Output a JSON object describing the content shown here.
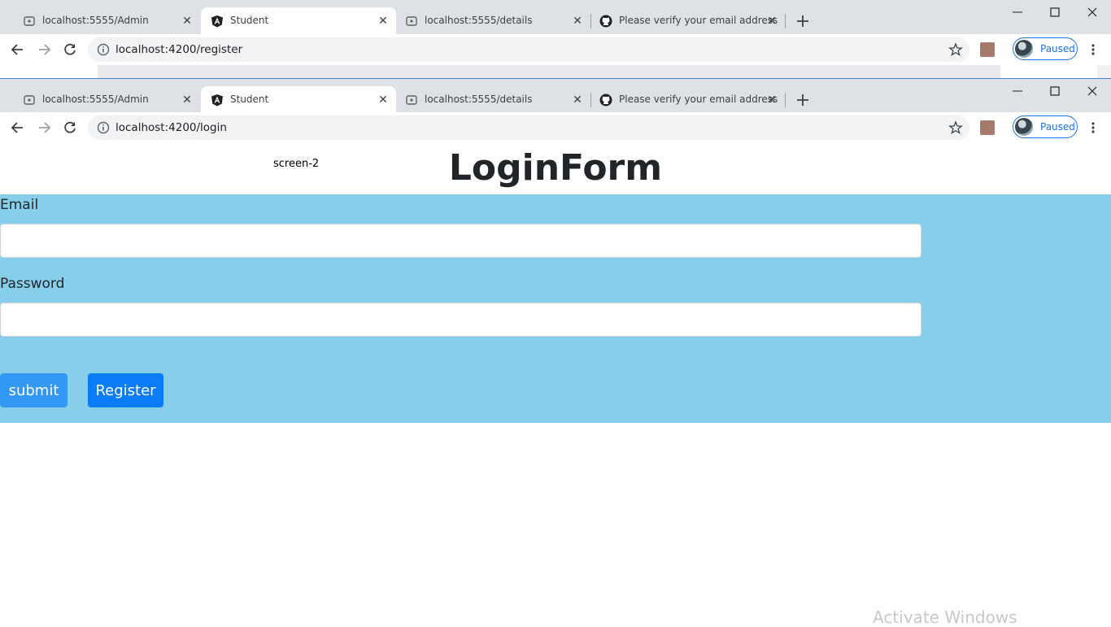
{
  "browser_back": {
    "tabs": [
      {
        "title": "localhost:5555/Admin",
        "favicon": "ionic-icon"
      },
      {
        "title": "Student",
        "favicon": "angular-icon"
      },
      {
        "title": "localhost:5555/details",
        "favicon": "ionic-icon"
      },
      {
        "title": "Please verify your email address",
        "favicon": "github-icon"
      }
    ],
    "url": "localhost:4200/register",
    "profile_label": "Paused"
  },
  "browser_front": {
    "tabs": [
      {
        "title": "localhost:5555/Admin",
        "favicon": "ionic-icon"
      },
      {
        "title": "Student",
        "favicon": "angular-icon"
      },
      {
        "title": "localhost:5555/details",
        "favicon": "ionic-icon"
      },
      {
        "title": "Please verify your email address",
        "favicon": "github-icon"
      }
    ],
    "url": "localhost:4200/login",
    "profile_label": "Paused"
  },
  "page": {
    "screen_label": "screen-2",
    "title": "LoginForm",
    "email_label": "Email",
    "email_value": "",
    "password_label": "Password",
    "password_value": "",
    "submit_label": "submit",
    "register_label": "Register"
  },
  "os": {
    "watermark": "Activate Windows"
  },
  "colors": {
    "form_bg": "#87ceeb",
    "submit_bg": "#3498f5",
    "register_bg": "#0a7cf7",
    "tabstrip_bg": "#dee1e6",
    "profile_accent": "#1a73e8"
  }
}
